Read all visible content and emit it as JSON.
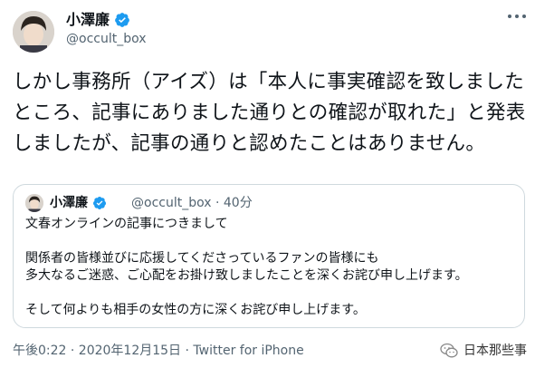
{
  "tweet": {
    "display_name": "小澤廉",
    "handle": "@occult_box",
    "text": "しかし事務所（アイズ）は「本人に事実確認を致しましたところ、記事にありました通りとの確認が取れた」と発表しましたが、記事の通りと認めたことはありません。"
  },
  "quoted_tweet": {
    "display_name": "小澤廉",
    "handle": "@occult_box",
    "separator": "·",
    "time": "40分",
    "lines": [
      "文春オンラインの記事につきまして",
      "",
      "関係者の皆様並びに応援してくださっているファンの皆様にも",
      "多大なるご迷惑、ご心配をお掛け致しましたことを深くお詫び申し上げます。",
      "",
      "そして何よりも相手の女性の方に深くお詫び申し上げます。"
    ]
  },
  "footer": {
    "timestamp": "午後0:22 · 2020年12月15日 · ",
    "source": "Twitter for iPhone"
  },
  "watermark": {
    "text": "日本那些事"
  },
  "icons": {
    "verified": "verified-badge-icon",
    "more": "more-options-icon",
    "watermark": "wechat-logo-icon"
  },
  "colors": {
    "verified": "#1d9bf0",
    "text": "#0f1419",
    "secondary": "#536471",
    "border": "#cfd9de"
  }
}
